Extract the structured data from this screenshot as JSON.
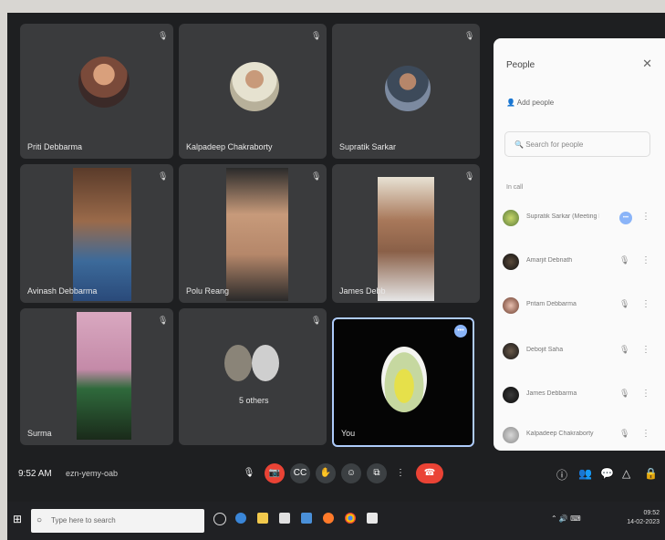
{
  "tiles": [
    {
      "name": "Priti Debbarma"
    },
    {
      "name": "Kalpadeep Chakraborty"
    },
    {
      "name": "Supratik Sarkar"
    },
    {
      "name": "Avinash Debbarma"
    },
    {
      "name": "Polu Reang"
    },
    {
      "name": "James Debb"
    },
    {
      "name": "Surma"
    },
    {
      "name": "5 others"
    },
    {
      "name": "You"
    }
  ],
  "people_panel": {
    "title": "People",
    "close": "✕",
    "add_people": "Add people",
    "search_placeholder": "Search for people",
    "section": "In call",
    "people": [
      {
        "name": "Supratik Sarkar (Meeting host)"
      },
      {
        "name": "Amarjit Debnath"
      },
      {
        "name": "Pritam Debbarma"
      },
      {
        "name": "Debojit Saha"
      },
      {
        "name": "James Debbarma"
      },
      {
        "name": "Kalpadeep Chakraborty"
      }
    ]
  },
  "bottom_bar": {
    "time": "9:52 AM",
    "meeting_code": "ezn-yemy-oab",
    "leave_icon": "☎"
  },
  "taskbar": {
    "search_placeholder": "Type here to search",
    "clock_time": "09:52",
    "clock_date": "14-02-2023"
  },
  "colors": {
    "leave_red": "#ea4335",
    "panel_bg": "#fafafa",
    "tile_bg": "#3a3b3d"
  }
}
